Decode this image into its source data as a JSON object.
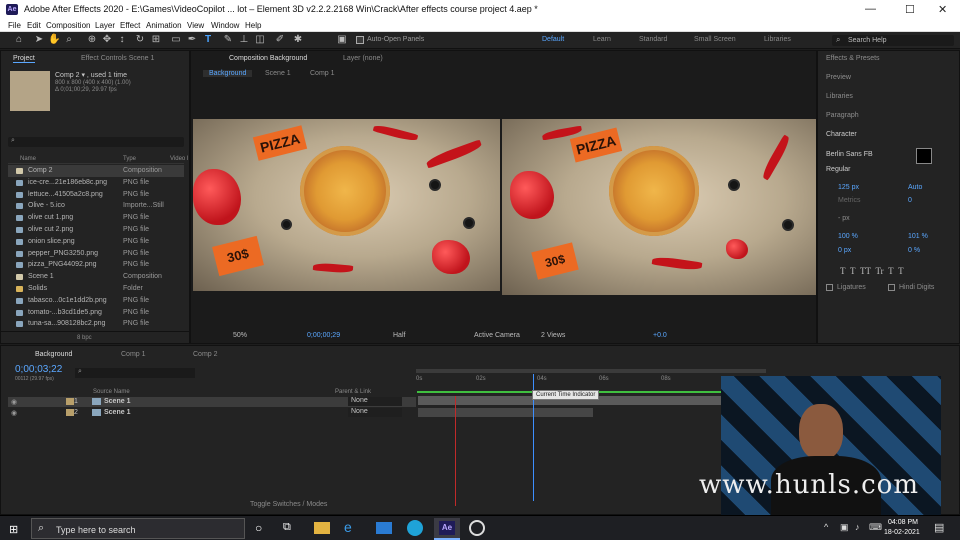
{
  "window": {
    "title": "Adobe After Effects 2020 - E:\\Games\\VideoCopilot ... lot – Element 3D v2.2.2.2168 Win\\Crack\\After effects course project 4.aep *",
    "minimize": "—",
    "maximize": "☐",
    "close": "✕"
  },
  "menu": [
    "File",
    "Edit",
    "Composition",
    "Layer",
    "Effect",
    "Animation",
    "View",
    "Window",
    "Help"
  ],
  "toolbar": {
    "auto_open": "Auto-Open Panels",
    "workspaces": [
      "Default",
      "Learn",
      "Standard",
      "Small Screen",
      "Libraries"
    ],
    "search_placeholder": "Search Help"
  },
  "project": {
    "tab": "Project",
    "effects_tab": "Effect Controls Scene 1",
    "comp_name": "Comp 2 ▾ , used 1 time",
    "comp_size": "800 x 800 (400 x 400) (1.00)",
    "comp_dur": "Δ 0;01;00;29, 29.97 fps",
    "col_name": "Name",
    "col_type": "Type",
    "col_video": "Video I",
    "bpc": "8 bpc",
    "items": [
      {
        "name": "Comp 2",
        "type": "Composition",
        "color": "#d2c9aa"
      },
      {
        "name": "ice-cre...21e186eb8c.png",
        "type": "PNG file",
        "color": "#8aa6bd"
      },
      {
        "name": "lettuce...41505a2c8.png",
        "type": "PNG file",
        "color": "#8aa6bd"
      },
      {
        "name": "Olive - 5.ico",
        "type": "Importe...Still",
        "color": "#8aa6bd"
      },
      {
        "name": "olive cut 1.png",
        "type": "PNG file",
        "color": "#8aa6bd"
      },
      {
        "name": "olive cut 2.png",
        "type": "PNG file",
        "color": "#8aa6bd"
      },
      {
        "name": "onion slice.png",
        "type": "PNG file",
        "color": "#8aa6bd"
      },
      {
        "name": "pepper_PNG3250.png",
        "type": "PNG file",
        "color": "#8aa6bd"
      },
      {
        "name": "pizza_PNG44092.png",
        "type": "PNG file",
        "color": "#8aa6bd"
      },
      {
        "name": "Scene 1",
        "type": "Composition",
        "color": "#d2c9aa"
      },
      {
        "name": "Solids",
        "type": "Folder",
        "color": "#d8b35a"
      },
      {
        "name": "tabasco...0c1e1dd2b.png",
        "type": "PNG file",
        "color": "#8aa6bd"
      },
      {
        "name": "tomato-...b3cd1de5.png",
        "type": "PNG file",
        "color": "#8aa6bd"
      },
      {
        "name": "tuna-sa...908128bc2.png",
        "type": "PNG file",
        "color": "#8aa6bd"
      }
    ]
  },
  "composition": {
    "tab": "Composition Background",
    "layer_tab": "Layer (none)",
    "breadcrumbs": [
      "Background",
      "Scene 1",
      "Comp 1"
    ],
    "pizza_label": "PIZZA",
    "price_label": "30$",
    "zoom": "50%",
    "timecode": "0;00;00;29",
    "resolution": "Half",
    "camera": "Active Camera",
    "views": "2 Views",
    "exposure": "+0.0"
  },
  "right": {
    "effects": "Effects & Presets",
    "preview": "Preview",
    "libraries": "Libraries",
    "paragraph": "Paragraph",
    "character": "Character",
    "font": "Berlin Sans FB",
    "style": "Regular",
    "size": "125 px",
    "leading": "Auto",
    "metrics": "Metrics",
    "tracking": "0",
    "indent": "- px",
    "vscale": "100 %",
    "hscale": "101 %",
    "baseline": "0 px",
    "tsume": "0 %",
    "ligatures": "Ligatures",
    "hindi": "Hindi Digits"
  },
  "timeline": {
    "tabs": [
      "Background",
      "Comp 1",
      "Comp 2"
    ],
    "timecode": "0;00;03;22",
    "fps": "00112 (29.97 fps)",
    "col_source": "Source Name",
    "col_parent": "Parent & Link",
    "ruler": [
      "0s",
      "02s",
      "04s",
      "06s",
      "08s"
    ],
    "tooltip": "Current Time Indicator",
    "toggle": "Toggle Switches / Modes",
    "layers": [
      {
        "num": "1",
        "name": "Scene 1",
        "parent": "None"
      },
      {
        "num": "2",
        "name": "Scene 1",
        "parent": "None"
      }
    ]
  },
  "watermark": "www.hunls.com",
  "taskbar": {
    "search": "Type here to search",
    "time": "04:08 PM",
    "date": "18-02-2021"
  },
  "colors": {
    "accent": "#2d8ceb",
    "timeline_green": "#3fbf3f",
    "price_tag": "#ec6a23"
  }
}
